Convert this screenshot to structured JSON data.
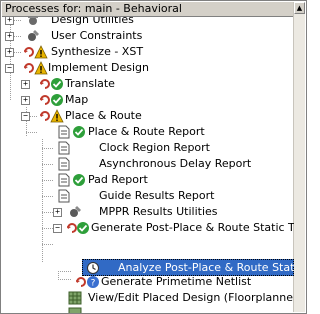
{
  "panel": {
    "header": "Processes for: main - Behavioral"
  },
  "tree": {
    "design_utilities": "Design Utilities",
    "user_constraints": "User Constraints",
    "synthesize": "Synthesize - XST",
    "implement_design": "Implement Design",
    "translate": "Translate",
    "map": "Map",
    "place_route": "Place & Route",
    "place_route_report": "Place & Route Report",
    "clock_region_report": "Clock Region Report",
    "async_delay_report": "Asynchronous Delay Report",
    "pad_report": "Pad Report",
    "guide_results_report": "Guide Results Report",
    "mppr_results_utilities": "MPPR Results Utilities",
    "generate_post_par_timing": "Generate Post-Place & Route Static Timi",
    "analyze_post_par_timing": "Analyze Post-Place & Route Static T",
    "generate_primetime_netlist": "Generate Primetime Netlist",
    "view_edit_placed_design": "View/Edit Placed Design (Floorplanner)"
  },
  "icons": {
    "check_color": "#2e9f3a",
    "warn_color": "#e8b400",
    "question_color": "#3a6fd0",
    "run_color": "#c0392b",
    "selection_color": "#316ac5"
  }
}
